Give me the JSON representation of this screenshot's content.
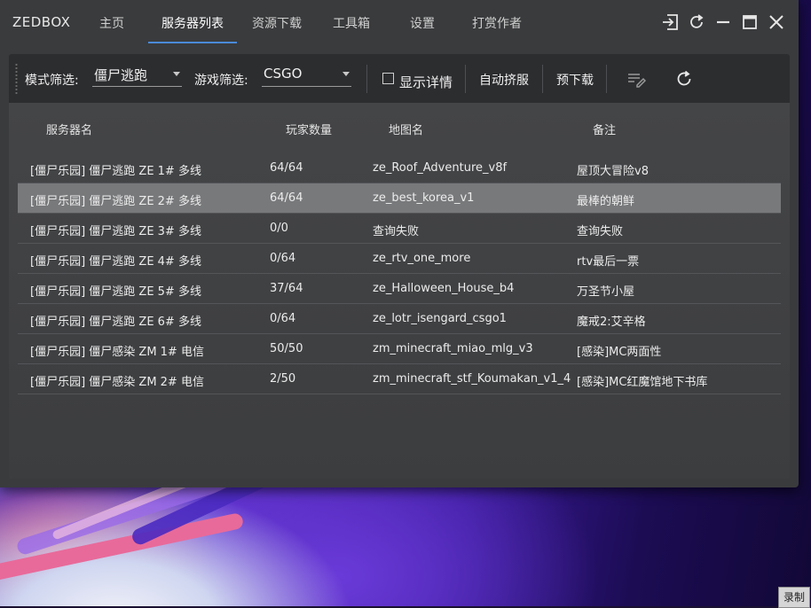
{
  "app": {
    "brand": "ZEDBOX",
    "nav": [
      {
        "label": "主页"
      },
      {
        "label": "服务器列表"
      },
      {
        "label": "资源下载"
      },
      {
        "label": "工具箱"
      },
      {
        "label": "设置"
      },
      {
        "label": "打赏作者"
      }
    ],
    "active_nav_index": 1,
    "window_controls": [
      "exit-icon",
      "refresh-icon",
      "minimize-icon",
      "maximize-icon",
      "close-icon"
    ]
  },
  "toolbar": {
    "mode_filter_label": "模式筛选:",
    "mode_filter_value": "僵尸逃跑",
    "game_filter_label": "游戏筛选:",
    "game_filter_value": "CSGO",
    "show_details_label": "显示详情",
    "show_details_checked": false,
    "auto_join_label": "自动挤服",
    "pre_download_label": "预下载",
    "icons": [
      "edit-list-icon",
      "refresh-icon"
    ]
  },
  "table": {
    "columns": [
      "服务器名",
      "玩家数量",
      "地图名",
      "备注"
    ],
    "rows": [
      {
        "name": "[僵尸乐园] 僵尸逃跑 ZE 1# 多线",
        "players": "64/64",
        "map": "ze_Roof_Adventure_v8f",
        "note": "屋顶大冒险v8"
      },
      {
        "name": "[僵尸乐园] 僵尸逃跑 ZE 2# 多线",
        "players": "64/64",
        "map": "ze_best_korea_v1",
        "note": "最棒的朝鲜"
      },
      {
        "name": "[僵尸乐园] 僵尸逃跑 ZE 3# 多线",
        "players": "0/0",
        "map": "查询失败",
        "note": "查询失败"
      },
      {
        "name": "[僵尸乐园] 僵尸逃跑 ZE 4# 多线",
        "players": "0/64",
        "map": "ze_rtv_one_more",
        "note": "rtv最后一票"
      },
      {
        "name": "[僵尸乐园] 僵尸逃跑 ZE 5# 多线",
        "players": "37/64",
        "map": "ze_Halloween_House_b4",
        "note": "万圣节小屋"
      },
      {
        "name": "[僵尸乐园] 僵尸逃跑 ZE 6# 多线",
        "players": "0/64",
        "map": "ze_lotr_isengard_csgo1",
        "note": "魔戒2:艾辛格"
      },
      {
        "name": "[僵尸乐园] 僵尸感染 ZM 1# 电信",
        "players": "50/50",
        "map": "zm_minecraft_miao_mlg_v3",
        "note": "[感染]MC两面性"
      },
      {
        "name": "[僵尸乐园] 僵尸感染 ZM 2# 电信",
        "players": "2/50",
        "map": "zm_minecraft_stf_Koumakan_v1_4",
        "note": "[感染]MC红魔馆地下书库"
      }
    ],
    "selected_row_index": 1
  },
  "desktop": {
    "record_badge": "录制"
  },
  "colors": {
    "window_bg": "#3a3b3d",
    "toolbar_bg": "#2c2d2f",
    "accent": "#4a8ad8",
    "selected_row": "#78797b"
  }
}
